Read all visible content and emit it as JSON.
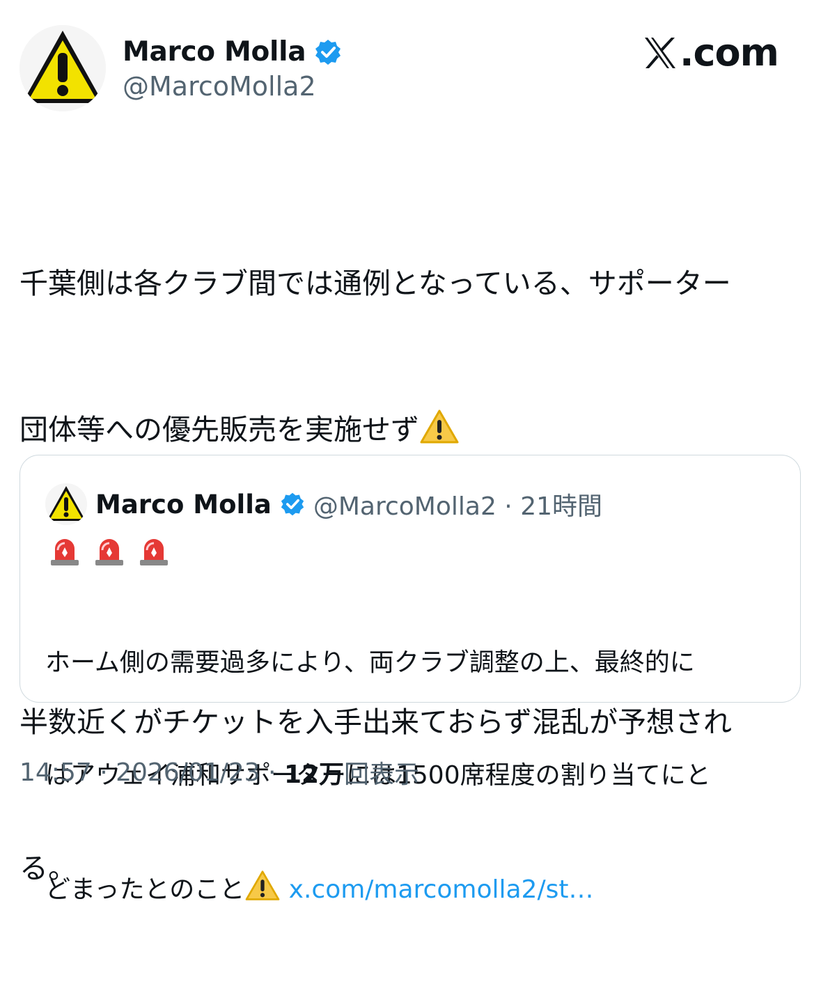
{
  "author": {
    "name": "Marco Molla",
    "handle": "@MarcoMolla2",
    "avatar_icon": "warning-sign-icon",
    "verified_icon": "verified-badge-icon"
  },
  "brand": {
    "logo_icon": "x-logo-icon",
    "logo_text": ".com"
  },
  "tweet": {
    "line1": "千葉側は各クラブ間では通例となっている、サポーター",
    "line2": "団体等への優先販売を実施せず",
    "line3": "",
    "line4": "半数近くがチケットを入手出来ておらず混乱が予想され",
    "line5": "る。"
  },
  "quote": {
    "name": "Marco Molla",
    "handle": "@MarcoMolla2",
    "separator": " · ",
    "time": "21時間",
    "siren_icon": "police-light-icon",
    "text_line1": "ホーム側の需要過多により、両クラブ調整の上、最終的に",
    "text_line2": "はアウェイ浦和サポーターには1500席程度の割り当てにと",
    "text_line3": "どまったとのこと",
    "link": "x.com/marcomolla2/st…"
  },
  "meta": {
    "time": "14:57",
    "sep1": " · ",
    "date": "2026/01/23",
    "sep2": " · ",
    "views_count": "12万",
    "views_label": "回表示"
  },
  "colors": {
    "link": "#1d9bf0",
    "secondary": "#536471",
    "verified": "#1d9bf0"
  }
}
